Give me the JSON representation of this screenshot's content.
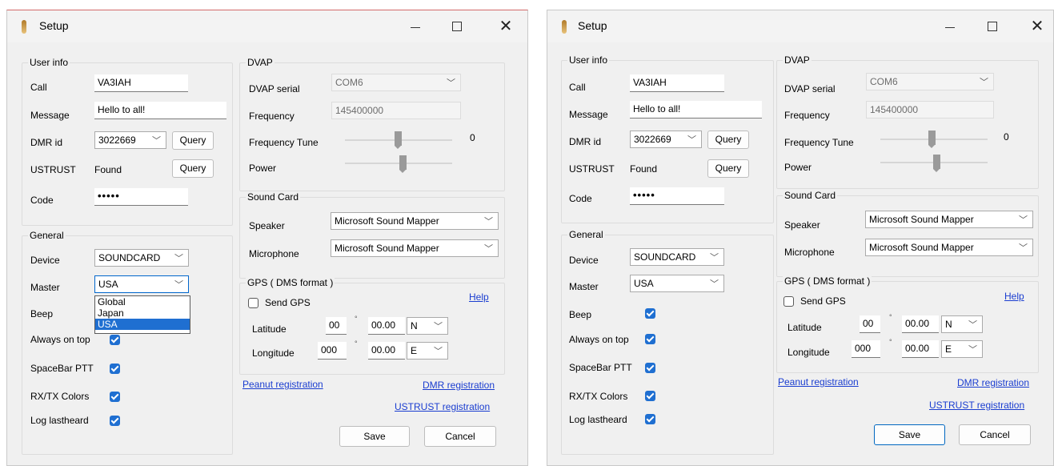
{
  "window": {
    "title": "Setup",
    "minimize": "—",
    "maximize": "",
    "close": "✕"
  },
  "groups": {
    "user_info": "User info",
    "general": "General",
    "dvap": "DVAP",
    "sound_card": "Sound Card",
    "gps": "GPS ( DMS format )"
  },
  "user_info": {
    "call_label": "Call",
    "call_value": "VA3IAH",
    "message_label": "Message",
    "message_value": "Hello to all!",
    "dmr_label": "DMR id",
    "dmr_value": "3022669",
    "ustrust_label": "USTRUST",
    "ustrust_status": "Found",
    "query_label": "Query",
    "code_label": "Code",
    "code_value": "•••••"
  },
  "general": {
    "device_label": "Device",
    "device_value": "SOUNDCARD",
    "master_label": "Master",
    "master_value": "USA",
    "master_options": [
      "Global",
      "Japan",
      "USA"
    ],
    "beep_label": "Beep",
    "always_on_top_label": "Always on top",
    "spacebar_label": "SpaceBar PTT",
    "rxtx_label": "RX/TX Colors",
    "log_label": "Log lastheard"
  },
  "dvap": {
    "serial_label": "DVAP serial",
    "serial_value": "COM6",
    "frequency_label": "Frequency",
    "frequency_value": "145400000",
    "tune_label": "Frequency Tune",
    "tune_value": "0",
    "power_label": "Power"
  },
  "sound": {
    "speaker_label": "Speaker",
    "speaker_value": "Microsoft Sound Mapper",
    "microphone_label": "Microphone",
    "microphone_value": "Microsoft Sound Mapper"
  },
  "gps": {
    "send_label": "Send GPS",
    "help_label": "Help",
    "lat_label": "Latitude",
    "lat_deg": "00",
    "lat_min": "00.00",
    "lat_dir": "N",
    "lon_label": "Longitude",
    "lon_deg": "000",
    "lon_min": "00.00",
    "lon_dir": "E",
    "degree_symbol": "°"
  },
  "links": {
    "peanut": "Peanut registration",
    "dmr": "DMR registration",
    "ustrust": "USTRUST registration"
  },
  "buttons": {
    "save": "Save",
    "cancel": "Cancel"
  },
  "colors": {
    "accent": "#1f6fd1",
    "link": "#1a3dd0",
    "window_bg": "#f0f0f0"
  }
}
